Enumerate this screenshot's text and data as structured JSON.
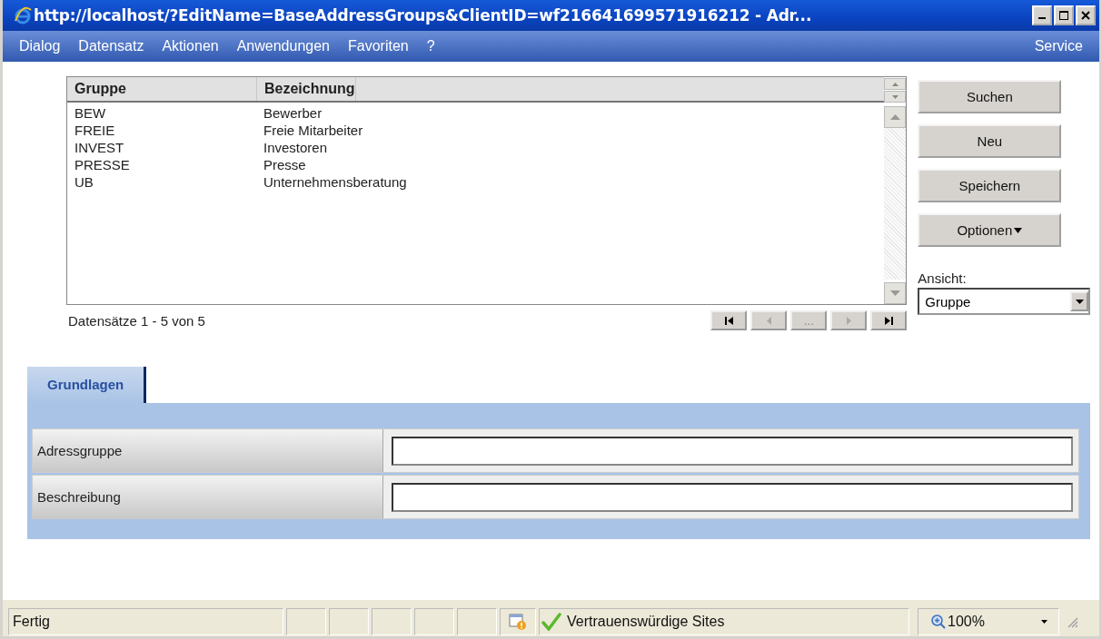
{
  "window": {
    "title": "http://localhost/?EditName=BaseAddressGroups&ClientID=wf216641699571916212 - Adr..."
  },
  "menu": {
    "items": [
      "Dialog",
      "Datensatz",
      "Aktionen",
      "Anwendungen",
      "Favoriten",
      "?"
    ],
    "right": "Service"
  },
  "table": {
    "columns": [
      "Gruppe",
      "Bezeichnung"
    ],
    "rows": [
      [
        "BEW",
        "Bewerber"
      ],
      [
        "FREIE",
        "Freie Mitarbeiter"
      ],
      [
        "INVEST",
        "Investoren"
      ],
      [
        "PRESSE",
        "Presse"
      ],
      [
        "UB",
        "Unternehmensberatung"
      ]
    ],
    "record_info": "Datensätze 1 - 5 von 5",
    "pager": [
      {
        "kind": "first",
        "disabled": false
      },
      {
        "kind": "prev",
        "disabled": true
      },
      {
        "kind": "more",
        "label": "...",
        "disabled": true
      },
      {
        "kind": "next",
        "disabled": true
      },
      {
        "kind": "last",
        "disabled": false
      }
    ]
  },
  "actions": [
    {
      "label": "Suchen",
      "dropdown": false
    },
    {
      "label": "Neu",
      "dropdown": false
    },
    {
      "label": "Speichern",
      "dropdown": false
    },
    {
      "label": "Optionen",
      "dropdown": true
    }
  ],
  "view": {
    "label": "Ansicht:",
    "value": "Gruppe"
  },
  "tabs": [
    {
      "label": "Grundlagen",
      "selected": true
    }
  ],
  "form": [
    {
      "label": "Adressgruppe"
    },
    {
      "label": "Beschreibung"
    }
  ],
  "status_bar": {
    "text": "Fertig",
    "zone": "Vertrauenswürdige Sites",
    "zoom": "100%"
  }
}
